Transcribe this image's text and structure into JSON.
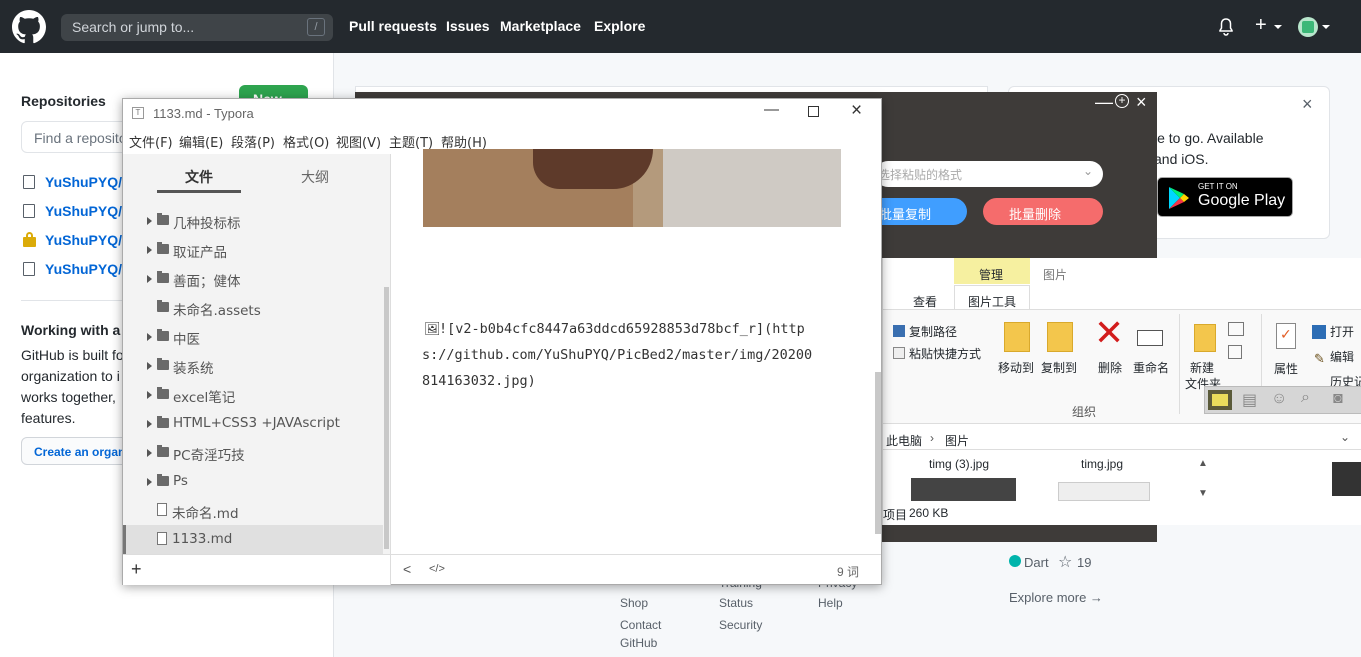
{
  "github": {
    "search_placeholder": "Search or jump to...",
    "search_shortcut": "/",
    "nav": [
      "Pull requests",
      "Issues",
      "Marketplace",
      "Explore"
    ],
    "new_button": "New",
    "repositories_heading": "Repositories",
    "find_repo_placeholder": "Find a reposito",
    "repos": [
      "YuShuPYQ/P",
      "YuShuPYQ/P",
      "YuShuPYQ/P",
      "YuShuPYQ/p"
    ],
    "working_heading": "Working with a",
    "working_text": [
      "GitHub is built fo",
      "organization to i",
      "works together, ",
      "features."
    ],
    "create_org": "Create an organ",
    "promo_text": [
      "le to go. Available",
      "and iOS."
    ],
    "google_play_small": "GET IT ON",
    "google_play_big": "Google Play",
    "dart_lang": "Dart",
    "dart_stars": "19",
    "explore_more": "Explore more →",
    "footer_col1": [
      "Shop",
      "Contact",
      "GitHub"
    ],
    "footer_col2": [
      "Status",
      "Security"
    ],
    "footer_col3": [
      "Help"
    ],
    "footer_partial": [
      "Training",
      "Privacy"
    ]
  },
  "typora": {
    "title": "1133.md - Typora",
    "menu": [
      "文件(F)",
      "编辑(E)",
      "段落(P)",
      "格式(O)",
      "视图(V)",
      "主题(T)",
      "帮助(H)"
    ],
    "tab_files": "文件",
    "tab_outline": "大纲",
    "tree": [
      {
        "label": "几种投标标",
        "type": "folder",
        "caret": true
      },
      {
        "label": "取证产品",
        "type": "folder",
        "caret": true
      },
      {
        "label": "善面；健体",
        "type": "folder",
        "caret": true
      },
      {
        "label": "未命名.assets",
        "type": "folder",
        "caret": false
      },
      {
        "label": "中医",
        "type": "folder",
        "caret": true
      },
      {
        "label": "装系统",
        "type": "folder",
        "caret": true
      },
      {
        "label": "excel笔记",
        "type": "folder",
        "caret": true
      },
      {
        "label": "HTML+CSS3 +JAVAscript",
        "type": "folder",
        "caret": true
      },
      {
        "label": "PC奇淫巧技",
        "type": "folder",
        "caret": true
      },
      {
        "label": "Ps",
        "type": "folder",
        "caret": true
      },
      {
        "label": "未命名.md",
        "type": "file",
        "caret": false
      },
      {
        "label": "1133.md",
        "type": "file",
        "caret": false
      }
    ],
    "add_symbol": "+",
    "content_lines": [
      "![v2-b0b4cfc8447a63ddcd65928853d78bcf_r](http",
      "s://github.com/YuShuPYQ/PicBed2/master/img/20200",
      "814163032.jpg)"
    ],
    "word_count": "9 词",
    "nav_back": "<",
    "source_mode": "</>"
  },
  "picgo": {
    "select_placeholder": "选择粘贴的格式",
    "batch_copy": "批量复制",
    "batch_delete": "批量删除"
  },
  "explorer": {
    "tab_manage": "管理",
    "tab_pictures": "图片",
    "tab_view": "查看",
    "tab_picture_tools": "图片工具",
    "copy_path": "复制路径",
    "paste_shortcut": "粘贴快捷方式",
    "move_to": "移动到",
    "copy_to": "复制到",
    "delete": "删除",
    "rename": "重命名",
    "new_folder": "新建",
    "new_folder2": "文件夹",
    "properties": "属性",
    "open": "打开",
    "edit": "编辑",
    "history": "历史记",
    "group_organize": "组织",
    "breadcrumb_pc": "此电脑",
    "breadcrumb_pictures": "图片",
    "file1": "timg (3).jpg",
    "file2": "timg.jpg",
    "status_items": "项目",
    "status_size": "260 KB"
  }
}
